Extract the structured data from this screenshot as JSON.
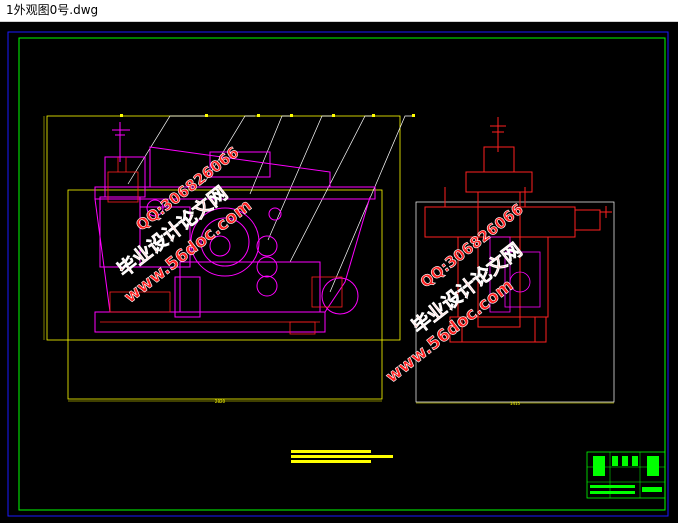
{
  "window": {
    "title": "1外观图0号.dwg"
  },
  "drawing": {
    "background_color": "#000000",
    "frame_color": "#1a1aff",
    "border_color": "#00ff00",
    "line_color_red": "#ff2020",
    "line_color_magenta": "#ff00ff",
    "line_color_yellow": "#ffff00",
    "line_color_white": "#ffffff",
    "front_view": {
      "width_dimension": "2820"
    },
    "side_view": {
      "width_dimension": "1415"
    },
    "title_block": {
      "icon": "title-block-icon"
    }
  },
  "watermarks": [
    {
      "line1": "毕业设计论文网",
      "line2": "www.56doc.com",
      "line3": "QQ:306826066"
    },
    {
      "line1": "毕业设计论文网",
      "line2": "www.56doc.com",
      "line3": "QQ:306826066"
    }
  ]
}
